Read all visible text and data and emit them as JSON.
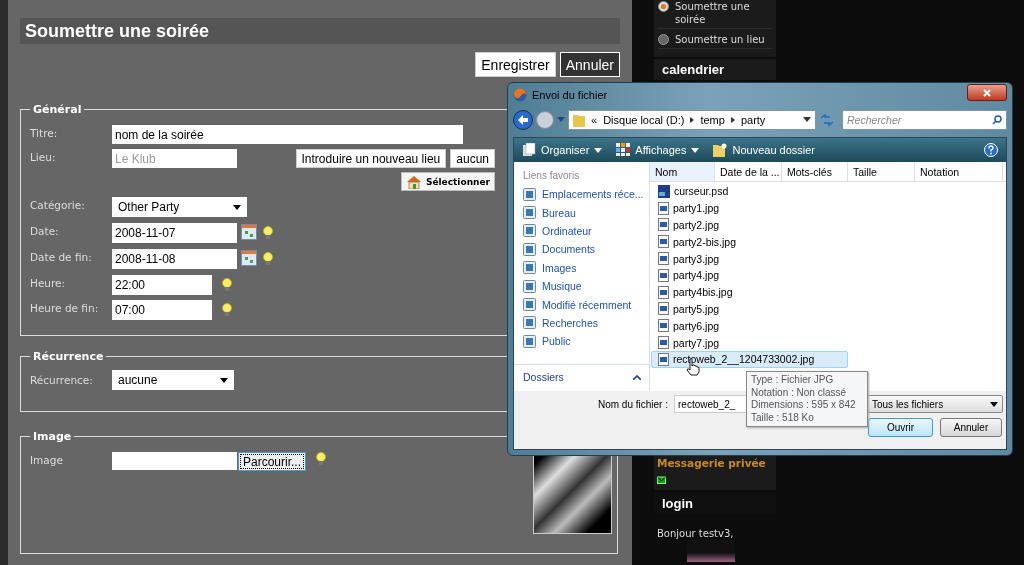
{
  "form": {
    "title": "Soumettre une soirée",
    "actions": [
      {
        "label": "Enregistrer"
      },
      {
        "label": "Annuler"
      }
    ],
    "sections": [
      {
        "legend": "Général",
        "rows": [
          {
            "kind": "text",
            "label": "Titre:",
            "value": "nom de la soirée"
          },
          {
            "kind": "place",
            "label": "Lieu:",
            "placeholder": "Le Klub",
            "buttons": [
              "Introduire un nouveau lieu",
              "aucun"
            ],
            "select_button": "Sélectionner"
          },
          {
            "kind": "select",
            "label": "Catégorie:",
            "value": "Other Party"
          },
          {
            "kind": "date",
            "label": "Date:",
            "value": "2008-11-07"
          },
          {
            "kind": "date",
            "label": "Date de fin:",
            "value": "2008-11-08"
          },
          {
            "kind": "time",
            "label": "Heure:",
            "value": "22:00"
          },
          {
            "kind": "time",
            "label": "Heure de fin:",
            "value": "07:00"
          }
        ]
      },
      {
        "legend": "Récurrence",
        "rows": [
          {
            "kind": "select",
            "label": "Récurrence:",
            "value": "aucune"
          }
        ]
      },
      {
        "legend": "Image",
        "rows": [
          {
            "kind": "file",
            "label": "Image",
            "button": "Parcourir..."
          }
        ]
      }
    ]
  },
  "sidebar": {
    "menu": [
      {
        "label": "Soumettre une soirée",
        "selected": true
      },
      {
        "label": "Soumettre un lieu",
        "selected": false
      }
    ],
    "calendar_title": "calendrier",
    "messaging_link": "Messagerie privée",
    "login_title": "login",
    "greeting": "Bonjour testv3,"
  },
  "dialog": {
    "title": "Envoi du fichier",
    "path": [
      "«",
      "Disque local (D:)",
      "temp",
      "party"
    ],
    "search_placeholder": "Rechercher",
    "toolbar": [
      "Organiser",
      "Affichages",
      "Nouveau dossier"
    ],
    "favorites_title": "Liens favoris",
    "favorites": [
      "Emplacements réce...",
      "Bureau",
      "Ordinateur",
      "Documents",
      "Images",
      "Musique",
      "Modifié récemment",
      "Recherches",
      "Public"
    ],
    "folders_label": "Dossiers",
    "columns": [
      "Nom",
      "Date de la ...",
      "Mots-clés",
      "Taille",
      "Notation"
    ],
    "files": [
      {
        "name": "curseur.psd",
        "kind": "psd",
        "selected": false
      },
      {
        "name": "party1.jpg",
        "kind": "jpg",
        "selected": false
      },
      {
        "name": "party2.jpg",
        "kind": "jpg",
        "selected": false
      },
      {
        "name": "party2-bis.jpg",
        "kind": "jpg",
        "selected": false
      },
      {
        "name": "party3.jpg",
        "kind": "jpg",
        "selected": false
      },
      {
        "name": "party4.jpg",
        "kind": "jpg",
        "selected": false
      },
      {
        "name": "party4bis.jpg",
        "kind": "jpg",
        "selected": false
      },
      {
        "name": "party5.jpg",
        "kind": "jpg",
        "selected": false
      },
      {
        "name": "party6.jpg",
        "kind": "jpg",
        "selected": false
      },
      {
        "name": "party7.jpg",
        "kind": "jpg",
        "selected": false
      },
      {
        "name": "rectoweb_2__1204733002.jpg",
        "kind": "jpg",
        "selected": true
      }
    ],
    "tooltip": [
      "Type : Fichier JPG",
      "Notation : Non classé",
      "Dimensions : 595 x 842",
      "Taille : 518 Ko"
    ],
    "filename_label": "Nom du fichier :",
    "filename_value": "rectoweb_2_",
    "filter": "Tous les fichiers",
    "buttons": [
      "Ouvrir",
      "Annuler"
    ]
  }
}
